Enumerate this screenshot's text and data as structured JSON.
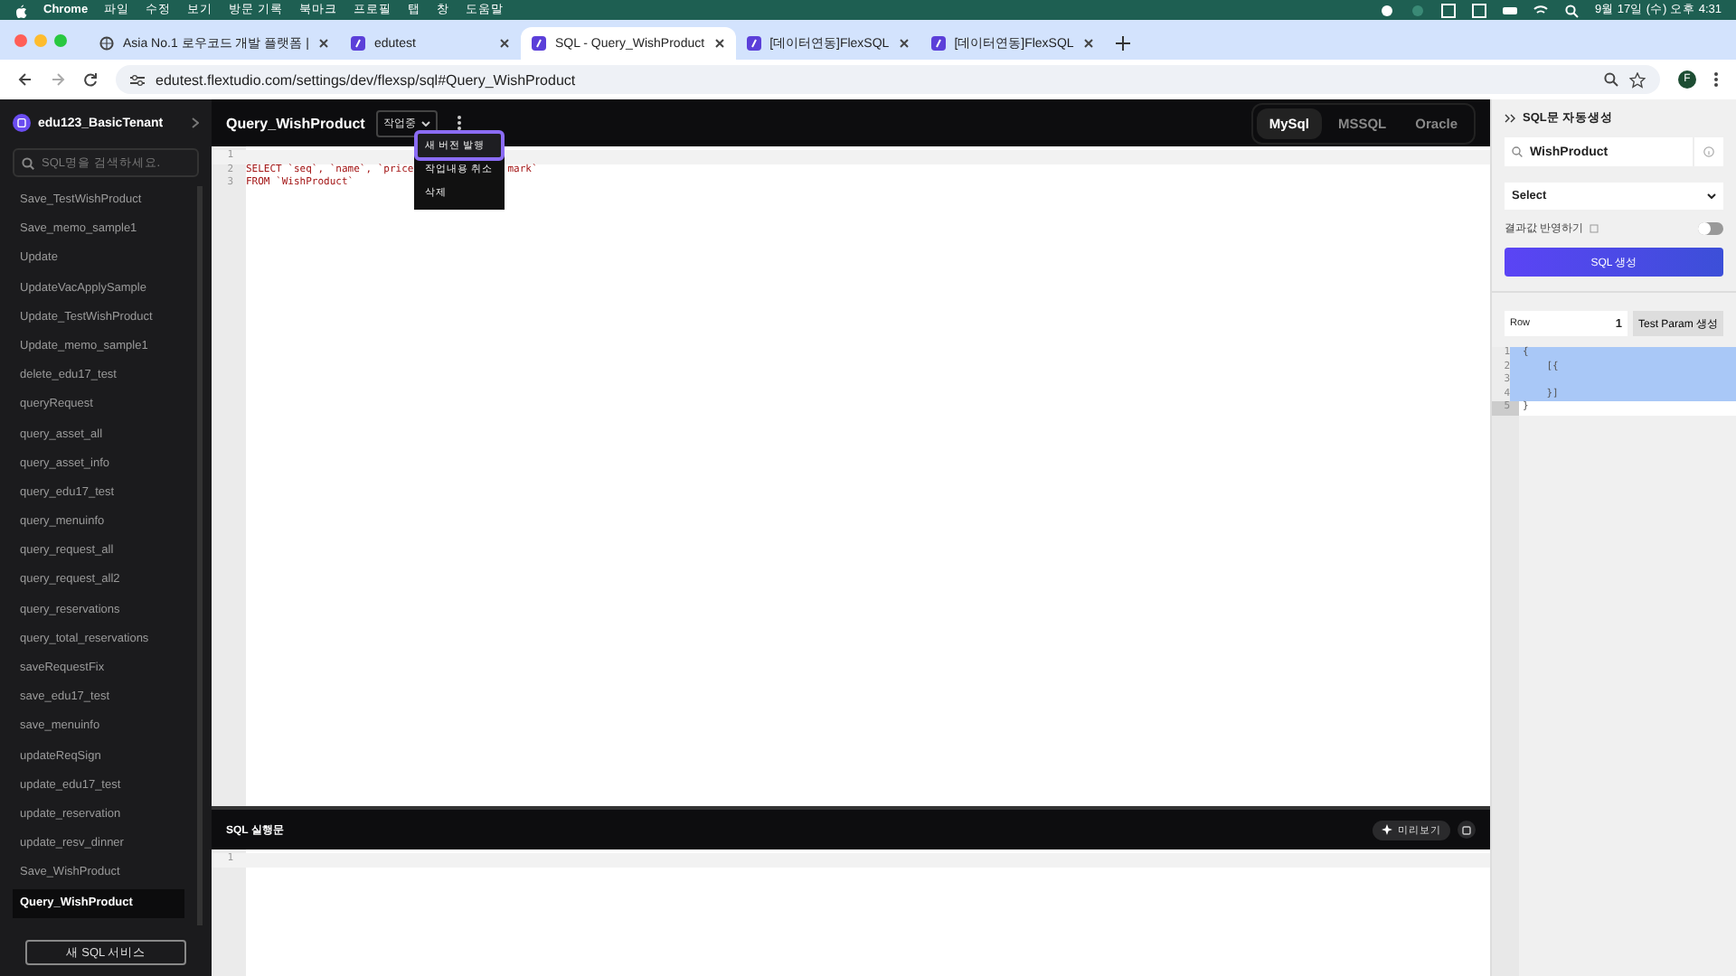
{
  "menubar": {
    "app": "Chrome",
    "items": [
      "파일",
      "수정",
      "보기",
      "방문 기록",
      "북마크",
      "프로필",
      "탭",
      "창",
      "도움말"
    ],
    "clock": "9월 17일 (수) 오후 4:31"
  },
  "tabs": [
    {
      "title": "Asia No.1 로우코드 개발 플랫폼 |",
      "selected": false
    },
    {
      "title": "edutest",
      "selected": false
    },
    {
      "title": "SQL - Query_WishProduct",
      "selected": true
    },
    {
      "title": "[데이터연동]FlexSQL",
      "selected": false
    },
    {
      "title": "[데이터연동]FlexSQL",
      "selected": false
    }
  ],
  "address": {
    "url": "edutest.flextudio.com/settings/dev/flexsp/sql#Query_WishProduct",
    "profile": "F"
  },
  "sidebar": {
    "tenant": "edu123_BasicTenant",
    "search_placeholder": "SQL명을 검색하세요.",
    "items": [
      {
        "label": "Save_TestWishProduct",
        "selected": false
      },
      {
        "label": "Save_memo_sample1",
        "selected": false
      },
      {
        "label": "Update",
        "selected": false
      },
      {
        "label": "UpdateVacApplySample",
        "selected": false
      },
      {
        "label": "Update_TestWishProduct",
        "selected": false
      },
      {
        "label": "Update_memo_sample1",
        "selected": false
      },
      {
        "label": "delete_edu17_test",
        "selected": false
      },
      {
        "label": "queryRequest",
        "selected": false
      },
      {
        "label": "query_asset_all",
        "selected": false
      },
      {
        "label": "query_asset_info",
        "selected": false
      },
      {
        "label": "query_edu17_test",
        "selected": false
      },
      {
        "label": "query_menuinfo",
        "selected": false
      },
      {
        "label": "query_request_all",
        "selected": false
      },
      {
        "label": "query_request_all2",
        "selected": false
      },
      {
        "label": "query_reservations",
        "selected": false
      },
      {
        "label": "query_total_reservations",
        "selected": false
      },
      {
        "label": "saveRequestFix",
        "selected": false
      },
      {
        "label": "save_edu17_test",
        "selected": false
      },
      {
        "label": "save_menuinfo",
        "selected": false
      },
      {
        "label": "updateReqSign",
        "selected": false
      },
      {
        "label": "update_edu17_test",
        "selected": false
      },
      {
        "label": "update_reservation",
        "selected": false
      },
      {
        "label": "update_resv_dinner",
        "selected": false
      },
      {
        "label": "Save_WishProduct",
        "selected": false
      },
      {
        "label": "Query_WishProduct",
        "selected": true
      }
    ],
    "new_button": "새 SQL 서비스"
  },
  "editor": {
    "title": "Query_WishProduct",
    "status": "작업중",
    "dialects": [
      {
        "label": "MySql",
        "selected": true
      },
      {
        "label": "MSSQL",
        "selected": false
      },
      {
        "label": "Oracle",
        "selected": false
      }
    ],
    "menu": [
      {
        "label": "새 버전 발행",
        "selected": true
      },
      {
        "label": "작업내용 취소",
        "selected": false
      },
      {
        "label": "삭제",
        "selected": false
      }
    ],
    "lines": [
      {
        "number": "1"
      },
      {
        "number": "2",
        "code": "SELECT `seq`, `name`, `price",
        "code_tail": "mark`"
      },
      {
        "number": "3",
        "code": "FROM `WishProduct`"
      }
    ]
  },
  "result": {
    "title": "SQL 실행문",
    "preview_button": "미리보기",
    "lines": [
      {
        "number": "1"
      }
    ]
  },
  "panel": {
    "title": "SQL문 자동생성",
    "search_value": "WishProduct",
    "select": "Select",
    "toggle_label": "결과값 반영하기",
    "toggle_on": false,
    "generate_button": "SQL 생성",
    "row_label": "Row",
    "row_value": "1",
    "param_button": "Test Param 생성",
    "json_lines": [
      {
        "number": "1",
        "code": "{"
      },
      {
        "number": "2",
        "code": "    [{"
      },
      {
        "number": "3"
      },
      {
        "number": "4",
        "code": "    }]"
      },
      {
        "number": "5",
        "code": "}"
      }
    ]
  }
}
